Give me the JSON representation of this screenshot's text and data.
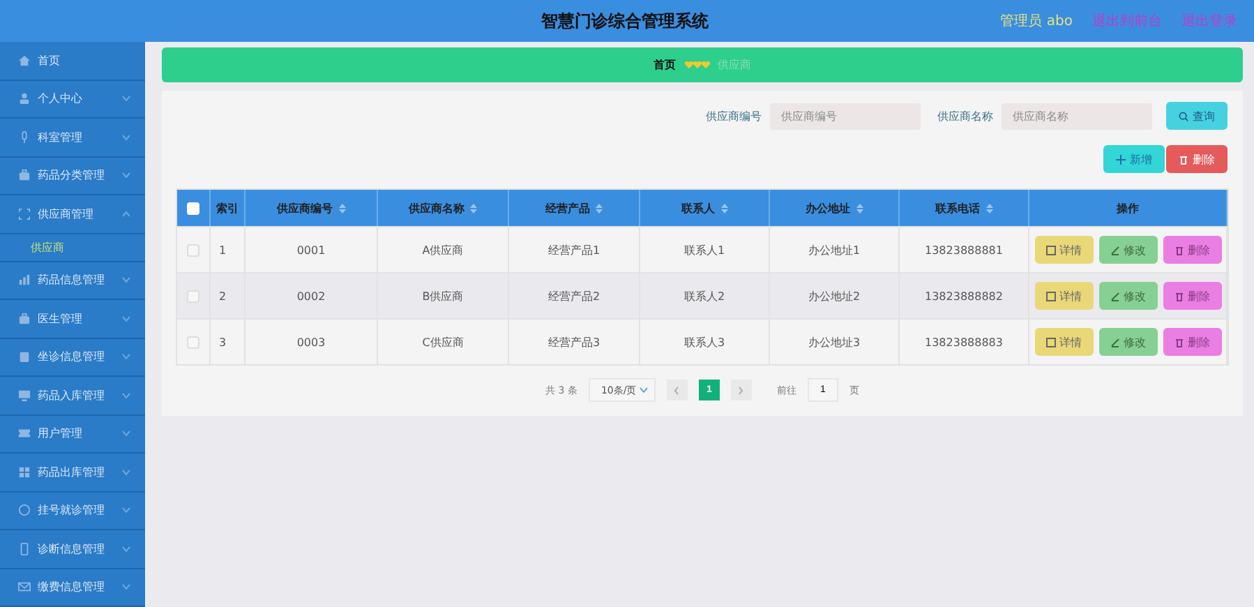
{
  "header": {
    "title": "智慧门诊综合管理系统",
    "user": "管理员 abo",
    "links": [
      "退出到前台",
      "退出登录"
    ]
  },
  "sidebar": {
    "items": [
      {
        "label": "首页"
      },
      {
        "label": "个人中心",
        "expanded": false
      },
      {
        "label": "科室管理",
        "expanded": false
      },
      {
        "label": "药品分类管理",
        "expanded": false
      },
      {
        "label": "供应商管理",
        "expanded": true,
        "children": [
          {
            "label": "供应商",
            "selected": true
          }
        ]
      },
      {
        "label": "药品信息管理",
        "expanded": false
      },
      {
        "label": "医生管理",
        "expanded": false
      },
      {
        "label": "坐诊信息管理",
        "expanded": false
      },
      {
        "label": "药品入库管理",
        "expanded": false
      },
      {
        "label": "用户管理",
        "expanded": false
      },
      {
        "label": "药品出库管理",
        "expanded": false
      },
      {
        "label": "挂号就诊管理",
        "expanded": false
      },
      {
        "label": "诊断信息管理",
        "expanded": false
      },
      {
        "label": "缴费信息管理",
        "expanded": false
      }
    ]
  },
  "breadcrumb": [
    "首页",
    "供应商"
  ],
  "search": {
    "fields": [
      {
        "label": "供应商编号",
        "placeholder": "供应商编号"
      },
      {
        "label": "供应商名称",
        "placeholder": "供应商名称"
      }
    ],
    "button": "查询"
  },
  "actions": [
    {
      "label": "新增",
      "kind": "add"
    },
    {
      "label": "删除",
      "kind": "delete"
    }
  ],
  "table": {
    "select_all_checked": false,
    "columns": [
      {
        "label": "索引",
        "sortable": false
      },
      {
        "label": "供应商编号",
        "sortable": true
      },
      {
        "label": "供应商名称",
        "sortable": true
      },
      {
        "label": "经营产品",
        "sortable": true
      },
      {
        "label": "联系人",
        "sortable": true
      },
      {
        "label": "办公地址",
        "sortable": true
      },
      {
        "label": "联系电话",
        "sortable": true
      },
      {
        "label": "操作",
        "sortable": false
      }
    ],
    "rows": [
      {
        "checked": false,
        "cells": [
          "1",
          "0001",
          "A供应商",
          "经营产品1",
          "联系人1",
          "办公地址1",
          "13823888881"
        ],
        "actions": [
          {
            "label": "详情",
            "kind": "detail"
          },
          {
            "label": "修改",
            "kind": "edit"
          },
          {
            "label": "删除",
            "kind": "delete"
          }
        ]
      },
      {
        "checked": false,
        "cells": [
          "2",
          "0002",
          "B供应商",
          "经营产品2",
          "联系人2",
          "办公地址2",
          "13823888882"
        ],
        "actions": [
          {
            "label": "详情",
            "kind": "detail"
          },
          {
            "label": "修改",
            "kind": "edit"
          },
          {
            "label": "删除",
            "kind": "delete"
          }
        ]
      },
      {
        "checked": false,
        "cells": [
          "3",
          "0003",
          "C供应商",
          "经营产品3",
          "联系人3",
          "办公地址3",
          "13823888883"
        ],
        "actions": [
          {
            "label": "详情",
            "kind": "detail"
          },
          {
            "label": "修改",
            "kind": "edit"
          },
          {
            "label": "删除",
            "kind": "delete"
          }
        ]
      }
    ]
  },
  "pagination": {
    "total": "共 3 条",
    "page_size": "10条/页",
    "pages": [
      {
        "label": "1",
        "selected": true
      }
    ],
    "goto_label": "前往",
    "goto_value": "1",
    "goto_suffix": "页"
  }
}
